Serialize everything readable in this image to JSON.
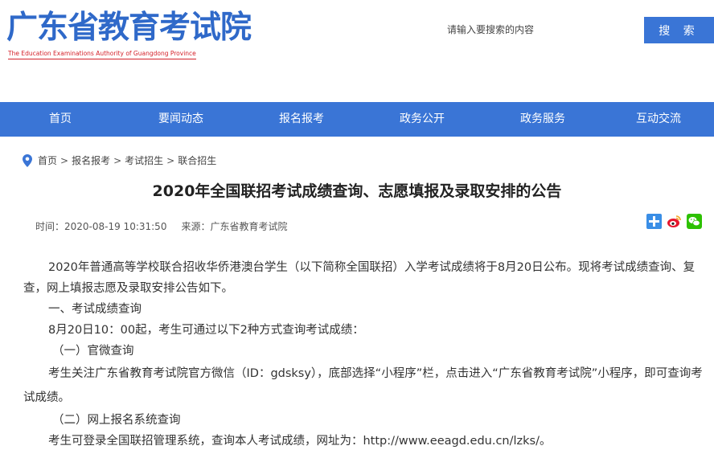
{
  "header": {
    "logo_title": "广东省教育考试院",
    "logo_subtitle": "The Education Examinations Authority of Guangdong Province",
    "search_placeholder": "请输入要搜索的内容",
    "search_button": "搜 索"
  },
  "nav": {
    "items": [
      "首页",
      "要闻动态",
      "报名报考",
      "政务公开",
      "政务服务",
      "互动交流"
    ]
  },
  "breadcrumb": {
    "items": [
      "首页",
      "报名报考",
      "考试招生",
      "联合招生"
    ],
    "separator": ">"
  },
  "article": {
    "title": "2020年全国联招考试成绩查询、志愿填报及录取安排的公告",
    "time_label": "时间：2020-08-19 10:31:50",
    "source_label": "来源：广东省教育考试院",
    "paragraphs": [
      "2020年普通高等学校联合招收华侨港澳台学生（以下简称全国联招）入学考试成绩将于8月20日公布。现将考试成绩查询、复查，网上填报志愿及录取安排公告如下。",
      "一、考试成绩查询",
      "8月20日10：00起，考生可通过以下2种方式查询考试成绩：",
      "（一）官微查询",
      "考生关注广东省教育考试院官方微信（ID：gdsksy），底部选择“小程序”栏，点击进入“广东省教育考试院”小程序，即可查询考试成绩。",
      "（二）网上报名系统查询",
      "考生可登录全国联招管理系统，查询本人考试成绩，网址为：http://www.eeagd.edu.cn/lzks/。"
    ]
  },
  "share": {
    "icons": [
      "share-plus-icon",
      "weibo-icon",
      "wechat-icon"
    ]
  },
  "colors": {
    "brand_blue": "#3a75d6",
    "logo_red": "#d4212a"
  }
}
